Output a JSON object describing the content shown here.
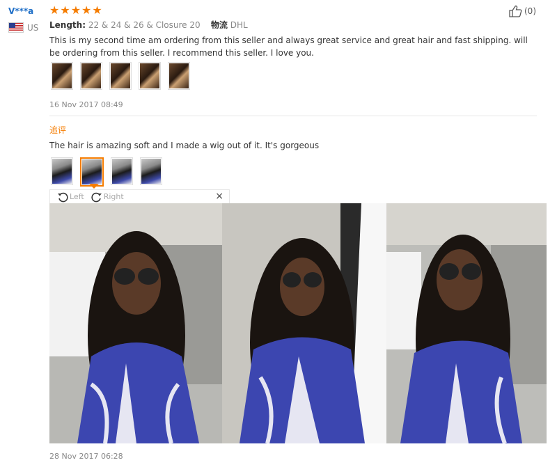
{
  "review": {
    "user_name": "V***a",
    "country": "US",
    "stars": "★★★★★",
    "likes": "(0)",
    "meta_label": "Length:",
    "meta_value": "22 & 24 & 26 & Closure 20",
    "shipping_label": "物流",
    "shipping_value": "DHL",
    "text": "This is my second time am ordering from this seller and always great service and great hair and fast shipping. will be ordering from this seller. I recommend this seller. I love you.",
    "date": "16 Nov 2017 08:49"
  },
  "followup": {
    "label": "追评",
    "text": "The hair is amazing soft and I made a wig out of it. It's gorgeous",
    "date": "28 Nov 2017 06:28"
  },
  "viewer": {
    "rotate_left": "Left",
    "rotate_right": "Right",
    "close": "×"
  },
  "colors": {
    "accent": "#f57c00",
    "user_link": "#1f6fc7"
  },
  "icons": [
    "thumbs-up-icon",
    "us-flag-icon",
    "rotate-left-icon",
    "rotate-right-icon",
    "close-icon"
  ]
}
